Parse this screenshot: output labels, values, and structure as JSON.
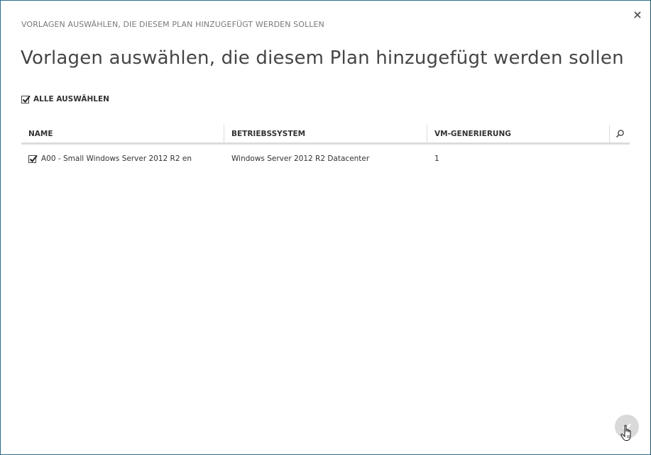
{
  "dialog": {
    "small_title": "VORLAGEN AUSWÄHLEN, DIE DIESEM PLAN HINZUGEFÜGT WERDEN SOLLEN",
    "title": "Vorlagen auswählen, die diesem Plan hinzugefügt werden sollen",
    "close_label": "×",
    "select_all_label": "ALLE AUSWÄHLEN",
    "select_all_checked": true
  },
  "table": {
    "columns": [
      "NAME",
      "BETRIEBSSYSTEM",
      "VM-GENERIERUNG"
    ],
    "rows": [
      {
        "checked": true,
        "name": "A00 - Small Windows Server 2012 R2 en",
        "os": "Windows Server 2012 R2 Datacenter",
        "generation": "1"
      }
    ]
  },
  "colors": {
    "border": "#2b6d8a",
    "ok_button": "#d9d9d9"
  },
  "icons": {
    "close": "close-icon",
    "search": "search-icon",
    "ok": "checkmark-icon",
    "cursor": "hand-cursor-icon"
  }
}
